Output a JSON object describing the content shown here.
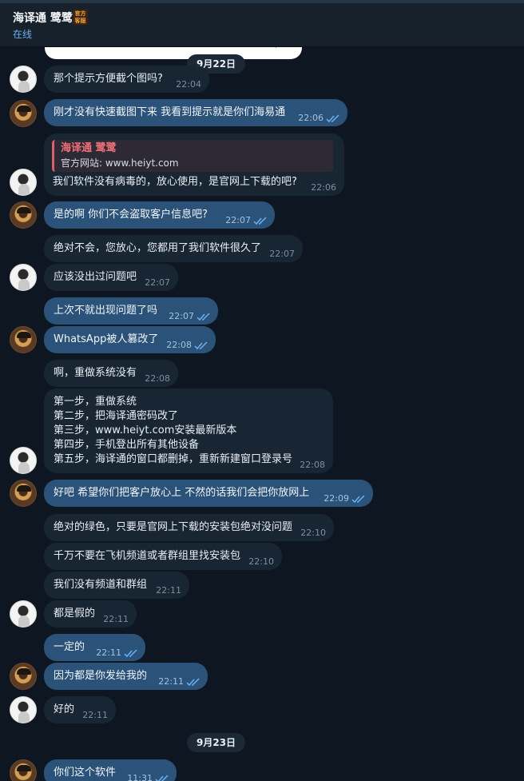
{
  "header": {
    "title": "海译通 鹭鹭",
    "badge": [
      "官方",
      "客服"
    ],
    "status": "在线"
  },
  "dates": [
    "9月22日",
    "9月23日"
  ],
  "quote": {
    "name": "海译通 鹭鹭",
    "text": "官方网站: www.heiyt.com"
  },
  "messages": [
    {
      "dir": "in",
      "text": "那个提示方便截个图吗?",
      "time": "22:04"
    },
    {
      "dir": "out",
      "text": "刚才没有快速截图下来 我看到提示就是你们海易通",
      "time": "22:06"
    },
    {
      "dir": "in",
      "text": "我们软件没有病毒的，放心使用，是官网上下载的吧?",
      "time": "22:06"
    },
    {
      "dir": "out",
      "text": "是的啊 你们不会盗取客户信息吧?",
      "time": "22:07"
    },
    {
      "dir": "in",
      "text": "绝对不会，您放心，您都用了我们软件很久了",
      "time": "22:07"
    },
    {
      "dir": "in",
      "text": "应该没出过问题吧",
      "time": "22:07"
    },
    {
      "dir": "out",
      "text": "上次不就出现问题了吗",
      "time": "22:07"
    },
    {
      "dir": "out",
      "text": "WhatsApp被人篡改了",
      "time": "22:08"
    },
    {
      "dir": "in",
      "text": "啊，重做系统没有",
      "time": "22:08"
    },
    {
      "dir": "in",
      "lines": [
        "第一步，重做系统",
        "第二步，把海译通密码改了",
        "第三步，www.heiyt.com安装最新版本",
        "第四步，手机登出所有其他设备",
        "第五步，海译通的窗口都删掉，重新新建窗口登录号"
      ],
      "time": "22:08"
    },
    {
      "dir": "out",
      "text": "好吧 希望你们把客户放心上 不然的话我们会把你放网上",
      "time": "22:09"
    },
    {
      "dir": "in",
      "text": "绝对的绿色，只要是官网上下载的安装包绝对没问题",
      "time": "22:10"
    },
    {
      "dir": "in",
      "text": "千万不要在飞机频道或者群组里找安装包",
      "time": "22:10"
    },
    {
      "dir": "in",
      "text": "我们没有频道和群组",
      "time": "22:11"
    },
    {
      "dir": "in",
      "text": "都是假的",
      "time": "22:11"
    },
    {
      "dir": "out",
      "text": "一定的",
      "time": "22:11"
    },
    {
      "dir": "out",
      "text": "因为都是你发给我的",
      "time": "22:11"
    },
    {
      "dir": "in",
      "text": "好的",
      "time": "22:11"
    },
    {
      "dir": "out",
      "text": "你们这个软件",
      "time": "11:31"
    }
  ],
  "icons": {
    "avatar_agent": "avatar-agent",
    "avatar_user": "avatar-user",
    "read_receipt": "double-check-icon"
  },
  "colors": {
    "background": "#0e1621",
    "incoming": "#182533",
    "outgoing": "#2b5278",
    "accent": "#6ab2f2",
    "quote_bar": "#e05e68"
  }
}
